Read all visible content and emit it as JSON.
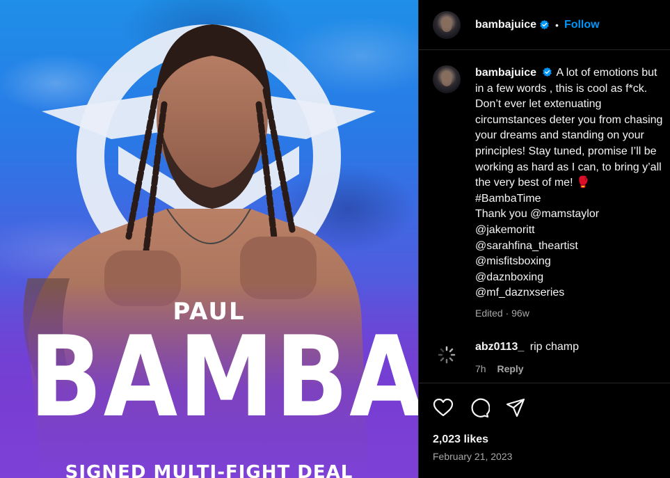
{
  "post": {
    "username": "bambajuice",
    "follow_label": "Follow",
    "image_text": {
      "first_name": "PAUL",
      "last_name": "BAMBA",
      "tagline": "SIGNED MULTI-FIGHT DEAL"
    },
    "caption": {
      "username": "bambajuice",
      "lines": [
        "A lot of emotions but",
        "in a few words , this is cool as f*ck.",
        "Don’t ever let extenuating",
        "circumstances deter you from chasing",
        "your dreams and standing on your",
        "principles! Stay tuned, promise I’ll be",
        "working as hard as I can, to bring y’all",
        "the very best of me! 🥊",
        "#BambaTime",
        "Thank you @mamstaylor",
        "@jakemoritt",
        "@sarahfina_theartist",
        "@misfitsboxing",
        "@daznboxing",
        "@mf_daznxseries"
      ],
      "meta": "Edited · 96w"
    },
    "comment": {
      "username": "abz0113_",
      "text": "rip champ",
      "time": "7h",
      "reply_label": "Reply"
    },
    "likes": "2,023 likes",
    "date": "February 21, 2023"
  },
  "icons": [
    "verified-icon",
    "heart-icon",
    "comment-icon",
    "share-icon",
    "loading-spinner-icon"
  ],
  "colors": {
    "background": "#000000",
    "accent": "#0095f6",
    "text": "#f5f5f5",
    "muted": "#a8a8a8",
    "divider": "#262626"
  }
}
